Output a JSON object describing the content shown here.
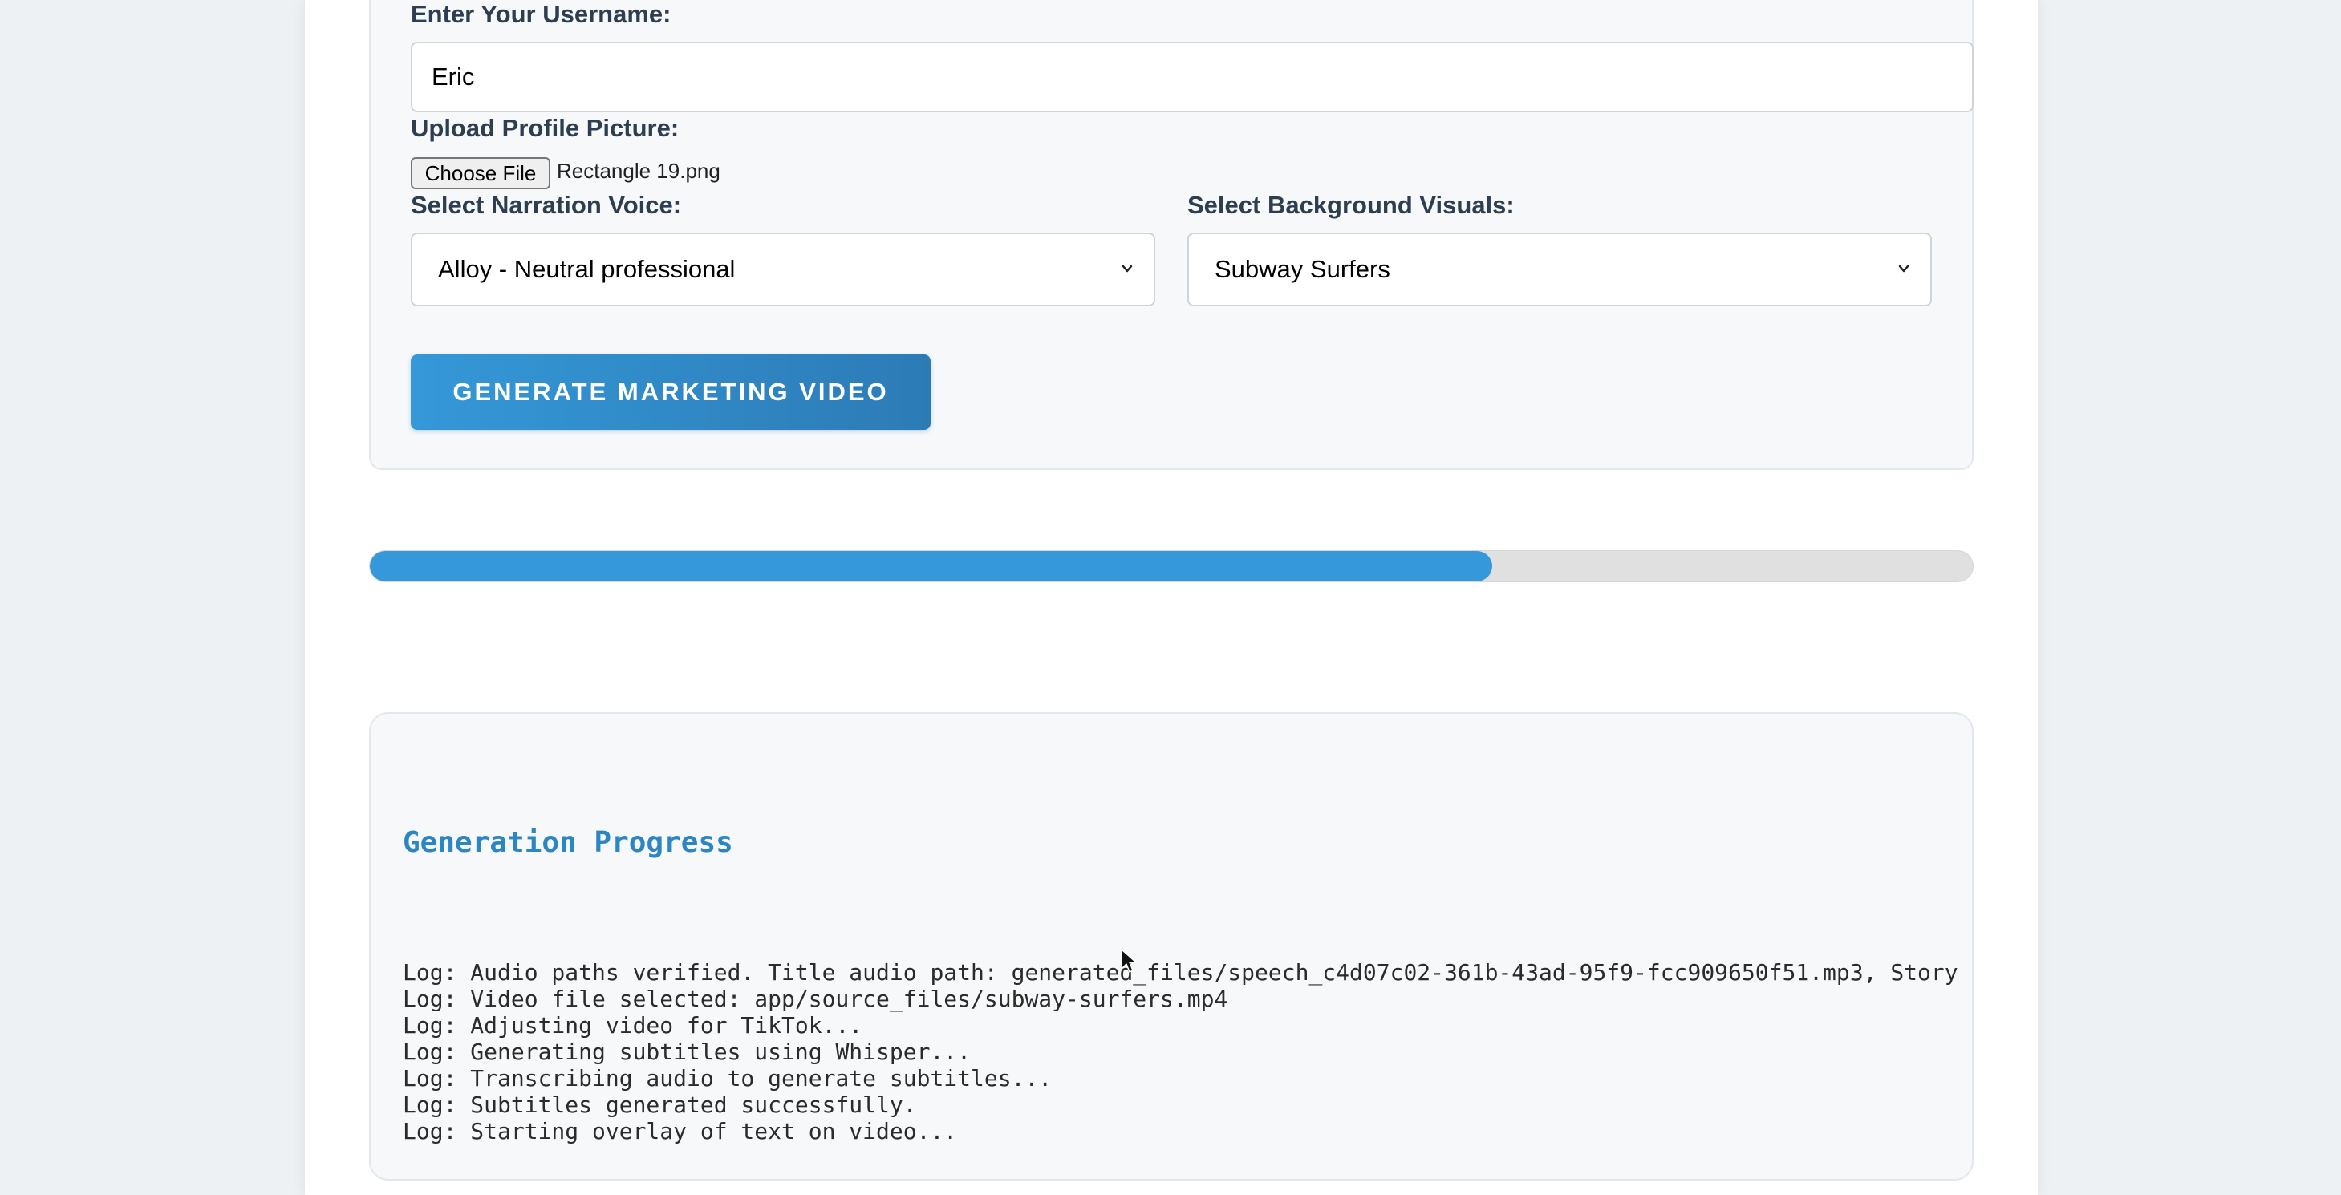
{
  "form": {
    "username_label": "Enter Your Username:",
    "username_value": "Eric",
    "upload_label": "Upload Profile Picture:",
    "choose_file_label": "Choose File",
    "file_name": "Rectangle 19.png",
    "voice_label": "Select Narration Voice:",
    "voice_selected": "Alloy - Neutral professional",
    "visuals_label": "Select Background Visuals:",
    "visuals_selected": "Subway Surfers",
    "generate_label": "GENERATE MARKETING VIDEO"
  },
  "progress": {
    "value": 0.7
  },
  "log": {
    "title": "Generation Progress",
    "lines": [
      "Log: Audio paths verified. Title audio path: generated_files/speech_c4d07c02-361b-43ad-95f9-fcc909650f51.mp3, Story",
      "Log: Video file selected: app/source_files/subway-surfers.mp4",
      "Log: Adjusting video for TikTok...",
      "Log: Generating subtitles using Whisper...",
      "Log: Transcribing audio to generate subtitles...",
      "Log: Subtitles generated successfully.",
      "Log: Starting overlay of text on video..."
    ]
  },
  "colors": {
    "accent": "#3498db",
    "label_text": "#2c3e50",
    "log_title": "#2d86c4"
  },
  "icons": {
    "select_chevron": "chevron-down-icon",
    "pointer": "mouse-cursor-icon"
  }
}
